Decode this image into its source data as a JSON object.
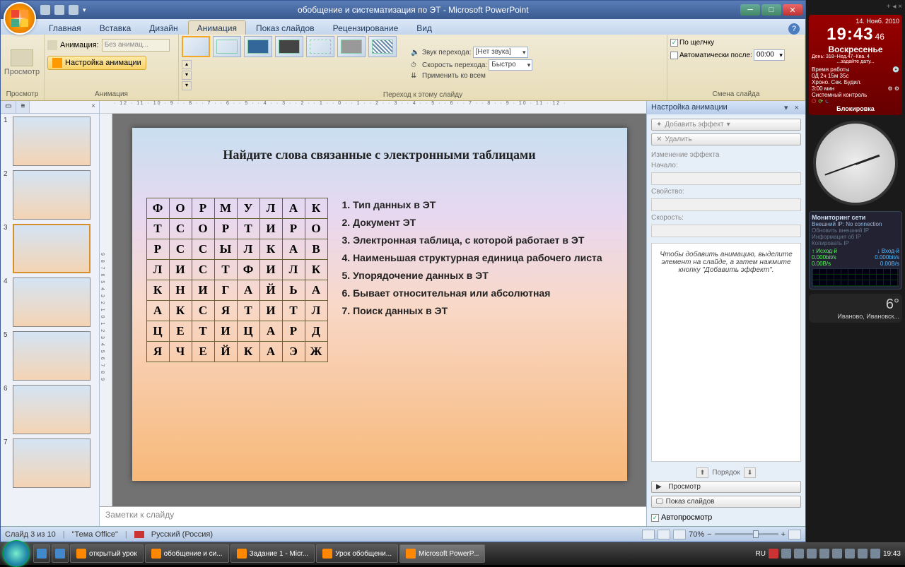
{
  "title": "обобщение и систематизация по ЭТ - Microsoft PowerPoint",
  "tabs": [
    "Главная",
    "Вставка",
    "Дизайн",
    "Анимация",
    "Показ слайдов",
    "Рецензирование",
    "Вид"
  ],
  "activeTab": 3,
  "ribbon": {
    "preview": "Просмотр",
    "anim_group": "Анимация",
    "anim_label": "Анимация:",
    "anim_value": "Без анимац...",
    "custom_anim": "Настройка анимации",
    "trans_group": "Переход к этому слайду",
    "sound_label": "Звук перехода:",
    "sound_value": "[Нет звука]",
    "speed_label": "Скорость перехода:",
    "speed_value": "Быстро",
    "apply_all": "Применить ко всем",
    "advance_group": "Смена слайда",
    "on_click": "По щелчку",
    "auto_after": "Автоматически после:",
    "auto_time": "00:00"
  },
  "slidePanel": {
    "tab1": "",
    "count": 7,
    "selected": 3
  },
  "slide": {
    "title": "Найдите слова связанные с электронными таблицами",
    "grid": [
      [
        "Ф",
        "О",
        "Р",
        "М",
        "У",
        "Л",
        "А",
        "К"
      ],
      [
        "Т",
        "С",
        "О",
        "Р",
        "Т",
        "И",
        "Р",
        "О"
      ],
      [
        "Р",
        "С",
        "С",
        "Ы",
        "Л",
        "К",
        "А",
        "В"
      ],
      [
        "Л",
        "И",
        "С",
        "Т",
        "Ф",
        "И",
        "Л",
        "К"
      ],
      [
        "К",
        "Н",
        "И",
        "Г",
        "А",
        "Й",
        "Ь",
        "А"
      ],
      [
        "А",
        "К",
        "С",
        "Я",
        "Т",
        "И",
        "Т",
        "Л"
      ],
      [
        "Ц",
        "Е",
        "Т",
        "И",
        "Ц",
        "А",
        "Р",
        "Д"
      ],
      [
        "Я",
        "Ч",
        "Е",
        "Й",
        "К",
        "А",
        "Э",
        "Ж"
      ]
    ],
    "clues": [
      "1. Тип данных в ЭТ",
      "2. Документ ЭТ",
      "3. Электронная таблица, с которой работает в ЭТ",
      "4. Наименьшая структурная единица рабочего листа",
      "5. Упорядочение данных в ЭТ",
      "6. Бывает относительная или абсолютная",
      "7. Поиск данных в ЭТ"
    ]
  },
  "notes_placeholder": "Заметки к слайду",
  "animPane": {
    "title": "Настройка анимации",
    "add_effect": "Добавить эффект",
    "delete": "Удалить",
    "change": "Изменение эффекта",
    "start": "Начало:",
    "property": "Свойство:",
    "speed": "Скорость:",
    "hint": "Чтобы добавить анимацию, выделите элемент на слайде, а затем нажмите кнопку \"Добавить эффект\".",
    "order": "Порядок",
    "preview": "Просмотр",
    "slideshow": "Показ слайдов",
    "autopreview": "Автопросмотр"
  },
  "status": {
    "slide": "Слайд 3 из 10",
    "theme": "\"Тема Office\"",
    "lang": "Русский (Россия)",
    "zoom": "70%"
  },
  "taskbar": {
    "items": [
      "открытый урок",
      "обобщение и си...",
      "Задание 1 - Micr...",
      "Урок обобщени...",
      "Microsoft PowerP..."
    ],
    "active": 4,
    "lang": "RU",
    "time": "19:43"
  },
  "sidebar": {
    "date": "14. Нояб. 2010",
    "time": "19:43",
    "sec": "46",
    "day": "Воскресенье",
    "dayinfo": "День: 318~Нед.47~Ква. 4",
    "setdate": "...задайте дату...",
    "uptime_l": "Время работы",
    "uptime": "0Д 2ч 15м 35с",
    "chrono_l": "Хроно.  Сек.  Будил.",
    "chrono": "3:00 мин",
    "sysctl": "Системный контроль",
    "lock": "Блокировка",
    "net_title": "Мониторинг сети",
    "net_ext": "Внешний IP: No connection",
    "net_refresh": "Обновить внешний IP",
    "net_info": "Информация об IP",
    "net_copy": "Копировать IP",
    "net_up": "↑ Исход-й",
    "net_up_v": "0.000bit/s",
    "net_up_b": "0.00B/s",
    "net_dn": "↓ Вход-й",
    "net_dn_v": "0.000bit/s",
    "net_dn_b": "0.00B/s",
    "weather_temp": "6°",
    "weather_loc": "Иваново, Ивановск..."
  }
}
